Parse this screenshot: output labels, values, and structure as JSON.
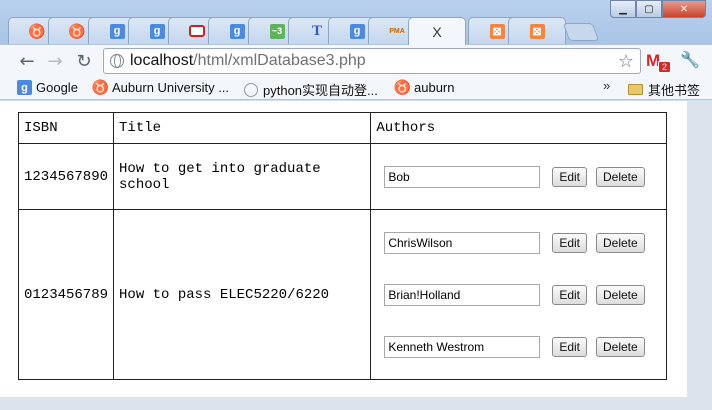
{
  "browser": {
    "url_host": "localhost",
    "url_path": "/html/xmlDatabase3.php",
    "active_tab_close": "X",
    "gmail_unread": "2",
    "tabs": [
      {
        "icon": "auburn-paw-icon"
      },
      {
        "icon": "auburn-paw-icon"
      },
      {
        "icon": "google-icon"
      },
      {
        "icon": "google-icon"
      },
      {
        "icon": "oracle-icon"
      },
      {
        "icon": "google-icon"
      },
      {
        "icon": "stepic-icon"
      },
      {
        "icon": "t-icon"
      },
      {
        "icon": "google-icon"
      },
      {
        "icon": "phpmyadmin-icon"
      },
      {
        "icon": "active-tab"
      },
      {
        "icon": "xampp-icon"
      },
      {
        "icon": "xampp-icon"
      }
    ]
  },
  "bookmarks": [
    {
      "label": "Google",
      "icon": "google-icon"
    },
    {
      "label": "Auburn University ...",
      "icon": "auburn-paw-icon"
    },
    {
      "label": "python实现自动登...",
      "icon": "clock-icon"
    },
    {
      "label": "auburn",
      "icon": "auburn-paw-icon"
    }
  ],
  "other_bookmarks": "其他书签",
  "table": {
    "headers": [
      "ISBN",
      "Title",
      "Authors"
    ],
    "rows": [
      {
        "isbn": "1234567890",
        "title": "How to get into graduate school",
        "authors": [
          "Bob"
        ]
      },
      {
        "isbn": "0123456789",
        "title": "How to pass ELEC5220/6220",
        "authors": [
          "ChrisWilson",
          "Brian!Holland",
          "Kenneth Westrom"
        ]
      }
    ]
  },
  "buttons": {
    "edit": "Edit",
    "delete": "Delete"
  },
  "colors": {
    "gmail_red": "#d62a2a",
    "xampp_orange": "#f4853e",
    "google_blue": "#4a8ae0"
  }
}
